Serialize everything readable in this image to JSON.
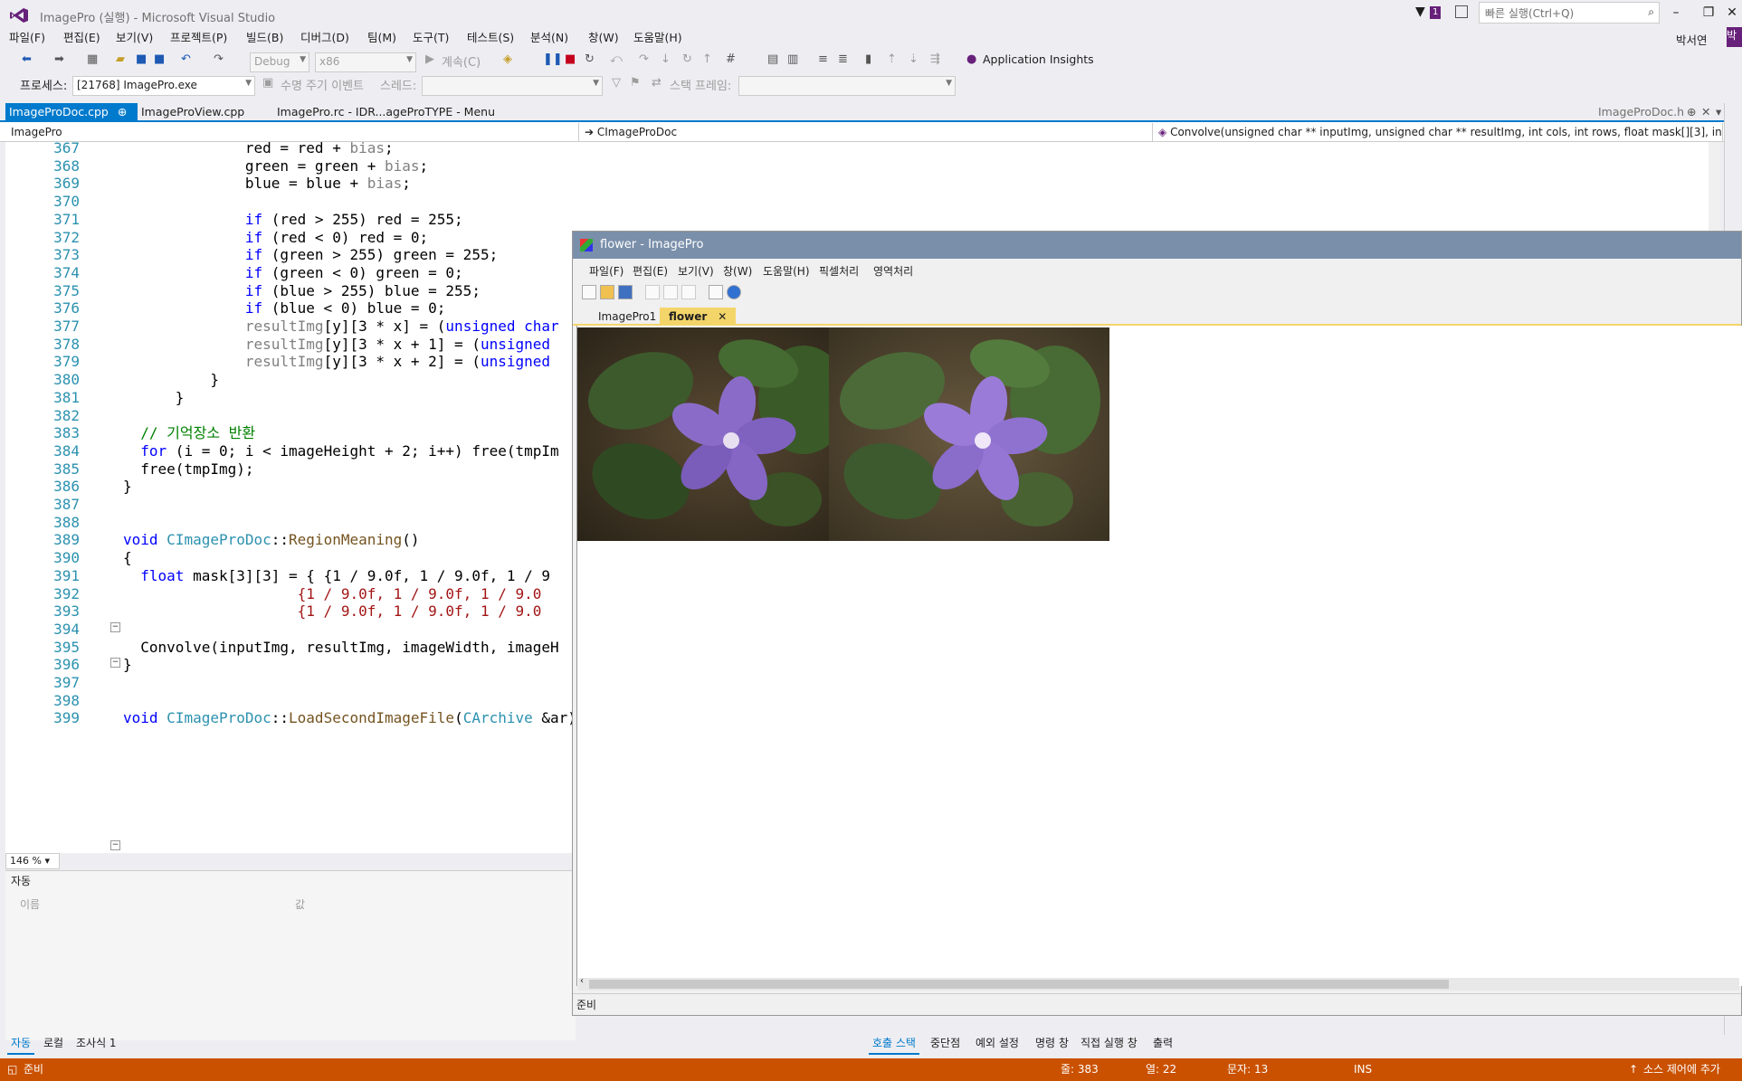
{
  "window": {
    "title": "ImagePro (실행) - Microsoft Visual Studio",
    "notif_count": "1",
    "quick_launch_placeholder": "빠른 실행(Ctrl+Q)",
    "user": "박서연",
    "user_badge": "박"
  },
  "menu": [
    "파일(F)",
    "편집(E)",
    "보기(V)",
    "프로젝트(P)",
    "빌드(B)",
    "디버그(D)",
    "팀(M)",
    "도구(T)",
    "테스트(S)",
    "분석(N)",
    "창(W)",
    "도움말(H)"
  ],
  "toolbar": {
    "config": "Debug",
    "platform": "x86",
    "continue": "계속(C)",
    "app_insights": "Application Insights"
  },
  "toolbar2": {
    "process_label": "프로세스:",
    "process_value": "[21768] ImagePro.exe",
    "lifecycle": "수명 주기 이벤트",
    "thread": "스레드:",
    "stack_frame": "스택 프레임:"
  },
  "tabs": [
    {
      "label": "ImageProDoc.cpp"
    },
    {
      "label": "ImageProView.cpp"
    },
    {
      "label": "ImagePro.rc - IDR...ageProTYPE - Menu"
    },
    {
      "label": "ImageProDoc.h"
    }
  ],
  "nav": {
    "project": "ImagePro",
    "class": "CImageProDoc",
    "member": "Convolve(unsigned char ** inputImg, unsigned char ** resultImg, int cols, int rows, float mask[][3], int bias, in"
  },
  "code": {
    "lines": [
      "367",
      "368",
      "369",
      "370",
      "371",
      "372",
      "373",
      "374",
      "375",
      "376",
      "377",
      "378",
      "379",
      "380",
      "381",
      "382",
      "383",
      "384",
      "385",
      "386",
      "387",
      "388",
      "389",
      "390",
      "391",
      "392",
      "393",
      "394",
      "395",
      "396",
      "397",
      "398",
      "399"
    ]
  },
  "zoom": "146 %",
  "autos": {
    "title": "자동",
    "col_name": "이름",
    "col_value": "값"
  },
  "bottom_tabs_left": [
    "자동",
    "로컬",
    "조사식 1"
  ],
  "bottom_tabs_right": [
    "호출 스택",
    "중단점",
    "예외 설정",
    "명령 창",
    "직접 실행 창",
    "출력"
  ],
  "status": {
    "ready": "준비",
    "line": "줄: 383",
    "col": "열: 22",
    "char": "문자: 13",
    "ins": "INS",
    "source_control": "소스 제어에 추가"
  },
  "child": {
    "title": "flower - ImagePro",
    "menu": [
      "파일(F)",
      "편집(E)",
      "보기(V)",
      "창(W)",
      "도움말(H)",
      "픽셀처리",
      "영역처리"
    ],
    "tabs": [
      "ImagePro1",
      "flower"
    ],
    "status": "준비"
  },
  "colors": {
    "accent": "#007acc",
    "status_bar": "#ca5100",
    "child_title": "#7a8faa",
    "child_tab_active": "#f4d56a"
  }
}
